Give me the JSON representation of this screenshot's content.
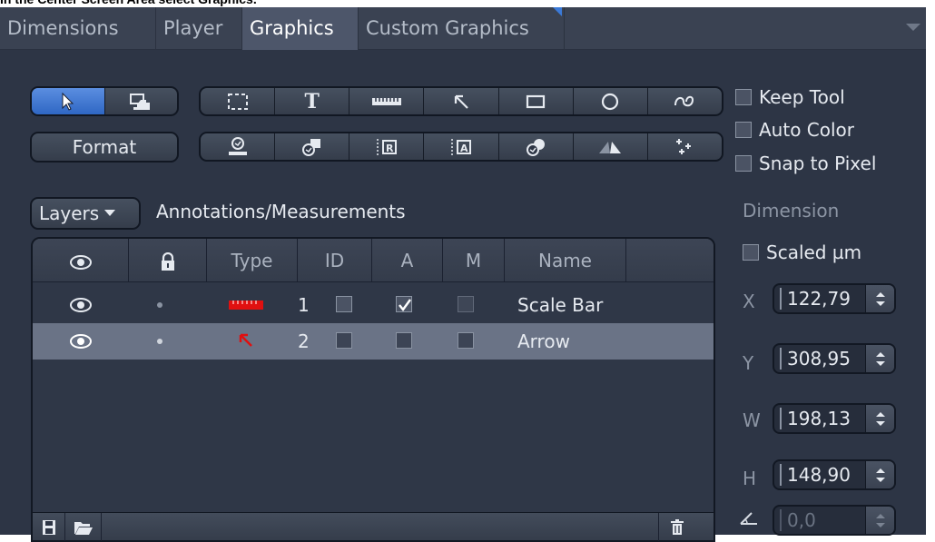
{
  "caption": "In the Center Screen Area select Graphics.",
  "tabs": [
    {
      "label": "Dimensions",
      "active": false
    },
    {
      "label": "Player",
      "active": false
    },
    {
      "label": "Graphics",
      "active": true
    },
    {
      "label": "Custom Graphics",
      "active": false
    }
  ],
  "toolbar": {
    "format_label": "Format",
    "row1_icons": [
      "select-rectangle-icon",
      "text-icon",
      "scale-bar-icon",
      "arrow-icon",
      "rectangle-icon",
      "circle-icon",
      "curve-icon"
    ],
    "row2_icons": [
      "circle-measure-icon",
      "marker-icon",
      "line-profile-icon",
      "line-profile-alt-icon",
      "multi-circle-icon",
      "angle-icon",
      "multi-point-icon"
    ],
    "mode_icons": [
      "pointer-icon",
      "overlay-icon"
    ]
  },
  "options": {
    "keep_tool": {
      "label": "Keep Tool",
      "checked": false
    },
    "auto_color": {
      "label": "Auto Color",
      "checked": false
    },
    "snap_to_pixel": {
      "label": "Snap to Pixel",
      "checked": false
    }
  },
  "layers": {
    "button_label": "Layers",
    "title": "Annotations/Measurements",
    "columns": {
      "type": "Type",
      "id": "ID",
      "a": "A",
      "m": "M",
      "name": "Name"
    },
    "rows": [
      {
        "id": "1",
        "a_checked": true,
        "m_checked": false,
        "name": "Scale Bar",
        "type_icon": "scale-bar-icon",
        "selected": false
      },
      {
        "id": "2",
        "a_checked": false,
        "m_checked": false,
        "name": "Arrow",
        "type_icon": "arrow-icon",
        "selected": true
      }
    ]
  },
  "dimension": {
    "title": "Dimension",
    "scaled_label": "Scaled µm",
    "scaled_checked": false,
    "x": {
      "label": "X",
      "value": "122,79"
    },
    "y": {
      "label": "Y",
      "value": "308,95"
    },
    "w": {
      "label": "W",
      "value": "198,13"
    },
    "h": {
      "label": "H",
      "value": "148,90"
    },
    "angle": {
      "value": "0,0",
      "disabled": true
    }
  },
  "colors": {
    "accent": "#3b7ad8",
    "panel_bg": "#2d3545",
    "icon_red": "#e01010"
  }
}
